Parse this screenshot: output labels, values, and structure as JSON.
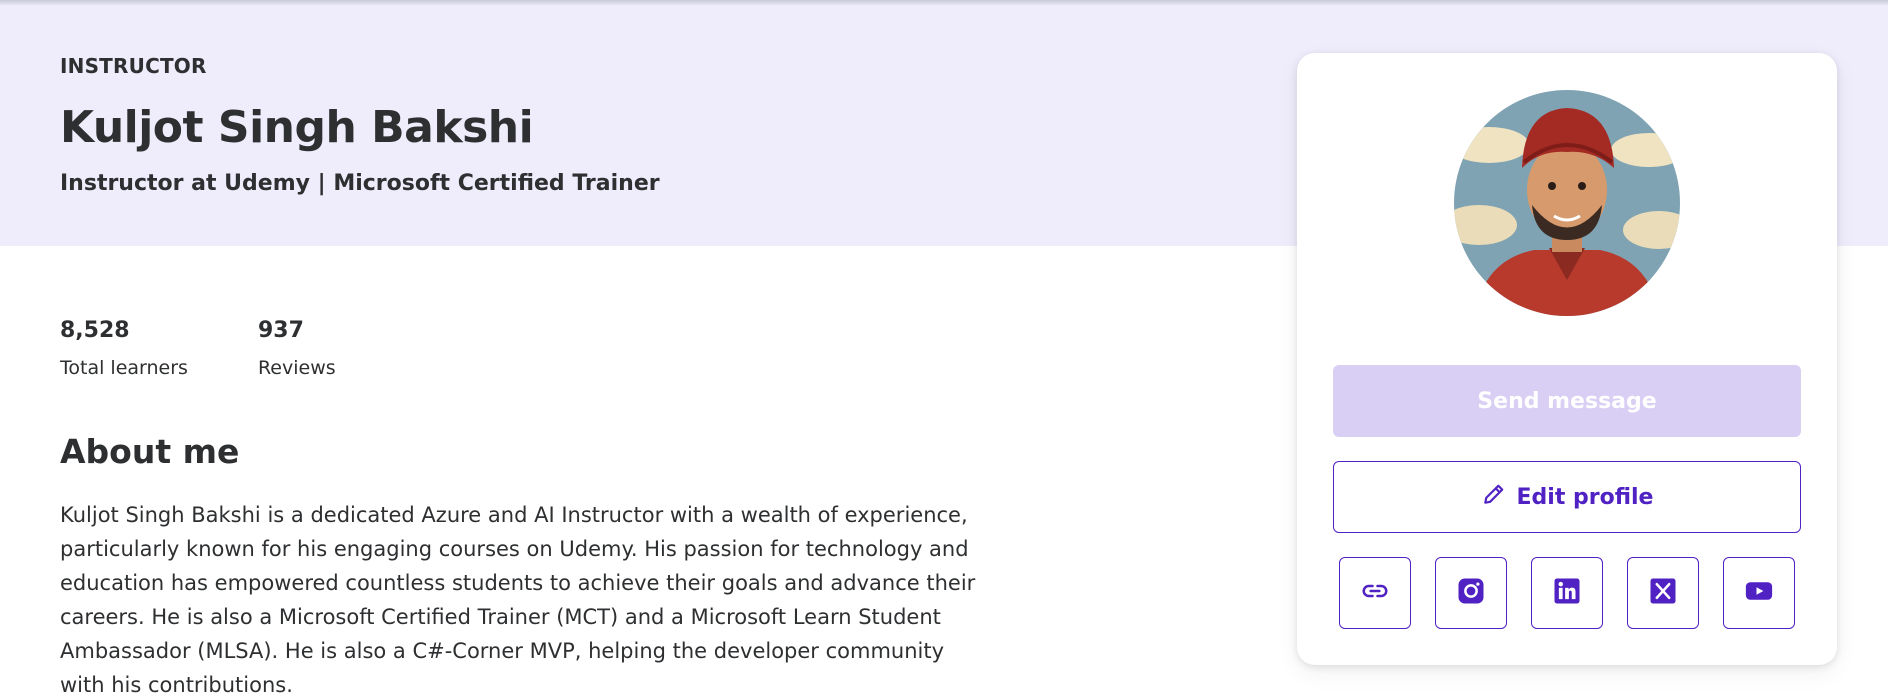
{
  "header": {
    "role": "INSTRUCTOR",
    "name": "Kuljot Singh Bakshi",
    "headline": "Instructor at Udemy | Microsoft Certified Trainer"
  },
  "stats": [
    {
      "value": "8,528",
      "label": "Total learners"
    },
    {
      "value": "937",
      "label": "Reviews"
    }
  ],
  "about": {
    "title": "About me",
    "text": "Kuljot Singh Bakshi is a dedicated Azure and AI Instructor with a wealth of experience, particularly known for his engaging courses on Udemy. His passion for technology and education has empowered countless students to achieve their goals and advance their careers. He is also a Microsoft Certified Trainer (MCT) and a Microsoft Learn Student Ambassador (MLSA). He is also a C#-Corner MVP, helping the developer community with his contributions."
  },
  "card": {
    "send_message_label": "Send message",
    "edit_profile_label": "Edit profile",
    "social_links": [
      "link-icon",
      "instagram-icon",
      "linkedin-icon",
      "x-icon",
      "youtube-icon"
    ]
  },
  "colors": {
    "hero_bg": "#efedfc",
    "accent": "#5022c3",
    "disabled_button": "#d9cef3",
    "text": "#2d2f31"
  }
}
